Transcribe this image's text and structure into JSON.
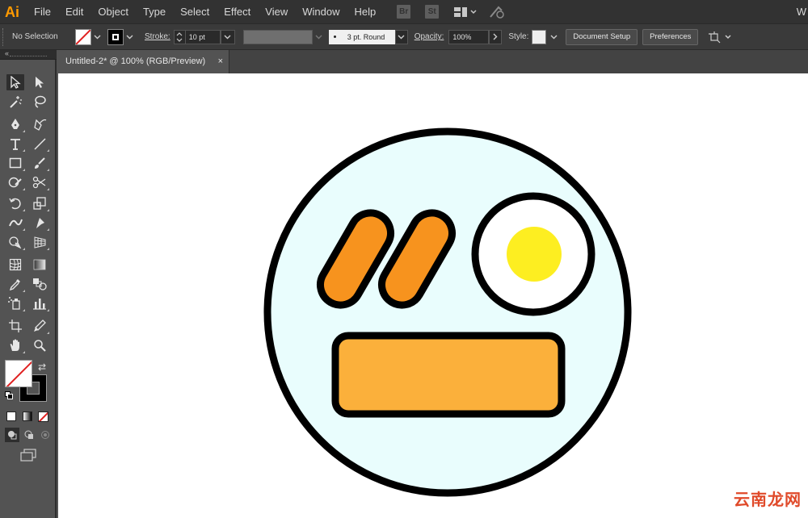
{
  "app": {
    "logo": "Ai",
    "workspace_label": "W"
  },
  "menu": [
    "File",
    "Edit",
    "Object",
    "Type",
    "Select",
    "Effect",
    "View",
    "Window",
    "Help"
  ],
  "app_badges": [
    "Br",
    "St"
  ],
  "control_bar": {
    "selection": "No Selection",
    "stroke_label": "Stroke:",
    "stroke_weight": "10 pt",
    "brush": "3 pt. Round",
    "opacity_label": "Opacity:",
    "opacity_value": "100%",
    "style_label": "Style:",
    "document_setup": "Document Setup",
    "preferences": "Preferences"
  },
  "document_tab": {
    "title": "Untitled-2* @ 100% (RGB/Preview)",
    "close": "×"
  },
  "tools": [
    "selection-tool",
    "direct-selection-tool",
    "magic-wand-tool",
    "lasso-tool",
    "pen-tool",
    "curvature-tool",
    "type-tool",
    "line-segment-tool",
    "rectangle-tool",
    "paintbrush-tool",
    "shaper-tool",
    "scissors-tool",
    "rotate-tool",
    "scale-tool",
    "width-tool",
    "puppet-warp-tool",
    "shape-builder-tool",
    "perspective-grid-tool",
    "mesh-tool",
    "gradient-tool",
    "eyedropper-tool",
    "blend-tool",
    "symbol-sprayer-tool",
    "column-graph-tool",
    "artboard-tool",
    "slice-tool",
    "hand-tool",
    "zoom-tool"
  ],
  "artwork": {
    "face_fill": "#e9fdfd",
    "outline": "#000000",
    "eyebrow_fill": "#f7931e",
    "egg_yolk": "#fdee21",
    "egg_white": "#ffffff",
    "mouth_fill": "#fbb03b"
  },
  "watermark": "云南龙网"
}
